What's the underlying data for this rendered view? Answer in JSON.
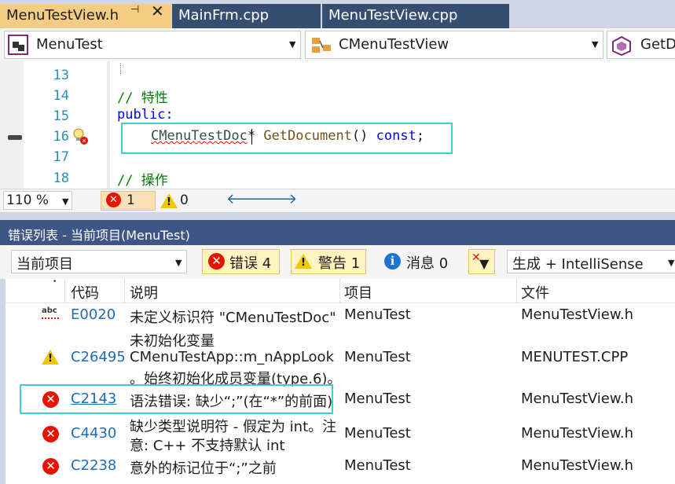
{
  "tabs": [
    {
      "label": "MenuTestView.h",
      "active": true
    },
    {
      "label": "MainFrm.cpp",
      "active": false
    },
    {
      "label": "MenuTestView.cpp",
      "active": false
    }
  ],
  "tab_pin_glyph": "⊣",
  "tab_close_glyph": "✕",
  "navbar": {
    "project": "MenuTest",
    "class": "CMenuTestView",
    "member": "GetD"
  },
  "editor": {
    "lines": [
      {
        "num": "13",
        "text": ""
      },
      {
        "num": "14",
        "text": "// 特性"
      },
      {
        "num": "15",
        "text": "public:"
      },
      {
        "num": "16",
        "text": "CMenuTestDoc* GetDocument() const;"
      },
      {
        "num": "17",
        "text": ""
      },
      {
        "num": "18",
        "text": "// 操作"
      }
    ],
    "line16": {
      "type": "CMenuTestDoc",
      "star": "*",
      "func": "GetDocument",
      "parens": "()",
      "kw": "const",
      "semi": ";"
    }
  },
  "status": {
    "zoom": "110 %",
    "errors": "1",
    "warnings": "0"
  },
  "error_list": {
    "title": "错误列表 - 当前项目(MenuTest)",
    "scope": "当前项目",
    "errors_btn": "错误 4",
    "warnings_btn": "警告 1",
    "messages_btn": "消息 0",
    "build_filter": "生成 + IntelliSense",
    "columns": {
      "code": "代码",
      "desc": "说明",
      "project": "项目",
      "file": "文件"
    },
    "rows": [
      {
        "icon": "abc-icon",
        "code": "E0020",
        "desc": [
          "未定义标识符 \"CMenuTestDoc\""
        ],
        "project": "MenuTest",
        "file": "MenuTestView.h"
      },
      {
        "icon": "warning-icon",
        "code": "C26495",
        "desc": [
          "未初始化变量",
          "CMenuTestApp::m_nAppLook",
          "。始终初始化成员变量(type.6)。"
        ],
        "project": "MenuTest",
        "file": "MENUTEST.CPP"
      },
      {
        "icon": "error-icon",
        "code": "C2143",
        "desc": [
          "语法错误: 缺少“;”(在“*”的前面)"
        ],
        "project": "MenuTest",
        "file": "MenuTestView.h"
      },
      {
        "icon": "error-icon",
        "code": "C4430",
        "desc": [
          "缺少类型说明符 - 假定为 int。注",
          "意: C++ 不支持默认 int"
        ],
        "project": "MenuTest",
        "file": "MenuTestView.h"
      },
      {
        "icon": "error-icon",
        "code": "C2238",
        "desc": [
          "意外的标记位于“;”之前"
        ],
        "project": "MenuTest",
        "file": "MenuTestView.h"
      }
    ]
  },
  "colors": {
    "active_tab": "#f5cc84",
    "title_bar": "#3f5585",
    "error_red": "#e51400",
    "highlight_cyan": "#3cd0d0"
  }
}
